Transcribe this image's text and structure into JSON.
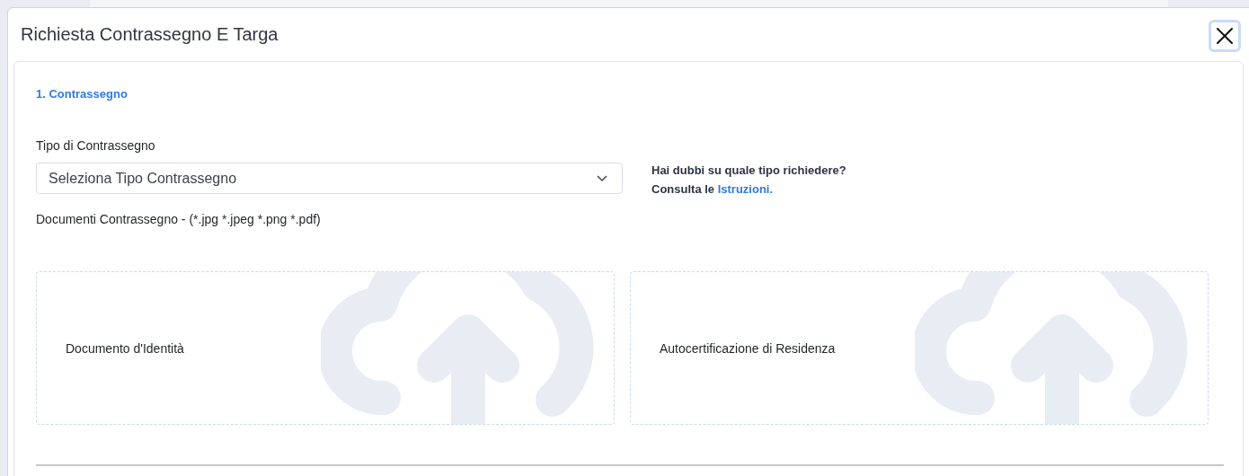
{
  "dialog": {
    "title": "Richiesta Contrassegno E Targa"
  },
  "section": {
    "heading": "1. Contrassegno",
    "type_field": {
      "label": "Tipo di Contrassegno",
      "placeholder": "Seleziona Tipo Contrassegno"
    },
    "help": {
      "question": "Hai dubbi su quale tipo richiedere?",
      "prefix": "Consulta le",
      "link": "Istruzioni."
    },
    "documents_label": "Documenti Contrassegno - (*.jpg *.jpeg *.png *.pdf)",
    "uploads": [
      {
        "label": "Documento d'Identità"
      },
      {
        "label": "Autocertificazione di Residenza"
      }
    ]
  }
}
